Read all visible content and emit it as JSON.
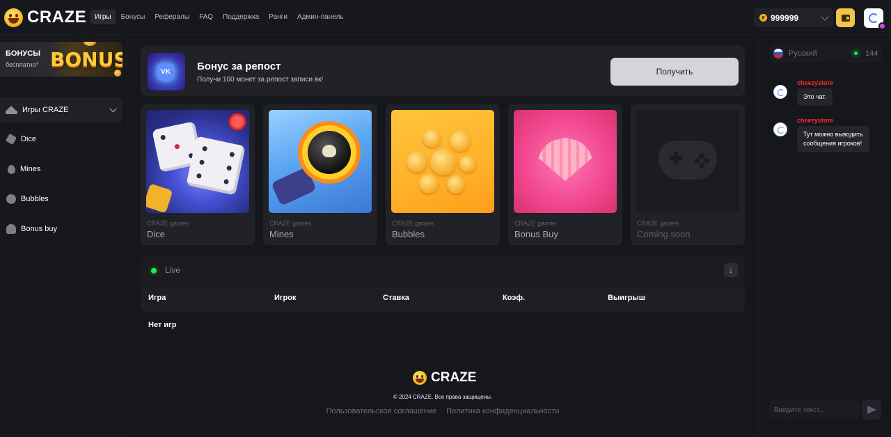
{
  "header": {
    "logo_text": "CRAZE",
    "nav": [
      {
        "label": "Игры",
        "active": true
      },
      {
        "label": "Бонусы"
      },
      {
        "label": "Рефералы"
      },
      {
        "label": "FAQ"
      },
      {
        "label": "Поддержка"
      },
      {
        "label": "Ранги"
      },
      {
        "label": "Админ-панель"
      }
    ],
    "balance": "999999",
    "coin_symbol": "₽"
  },
  "sidebar": {
    "bonus_title": "БОНУСЫ",
    "bonus_sub": "бесплатно*",
    "bonus_art": "BONUS",
    "games_toggle": "Игры CRAZE",
    "links": [
      {
        "label": "Dice",
        "icon": "dice-icon"
      },
      {
        "label": "Mines",
        "icon": "drop-icon"
      },
      {
        "label": "Bubbles",
        "icon": "smile-icon"
      },
      {
        "label": "Bonus buy",
        "icon": "shell-icon"
      }
    ]
  },
  "repost": {
    "title": "Бонус за репост",
    "subtitle": "Получи 100 монет за репост записи вк!",
    "button": "Получить",
    "badge": "VK"
  },
  "games": [
    {
      "provider": "CRAZE games",
      "name": "Dice"
    },
    {
      "provider": "CRAZE games",
      "name": "Mines"
    },
    {
      "provider": "CRAZE games",
      "name": "Bubbles"
    },
    {
      "provider": "CRAZE games",
      "name": "Bonus Buy"
    },
    {
      "provider": "CRAZE games",
      "name": "Coming soon"
    }
  ],
  "live": {
    "label": "Live",
    "columns": [
      "Игра",
      "Игрок",
      "Ставка",
      "Коэф.",
      "Выигрыш"
    ],
    "empty_text": "Нет игр"
  },
  "footer": {
    "logo_text": "CRAZE",
    "copyright": "© 2024 CRAZE. Все права защищены.",
    "links": [
      "Пользовательское соглашение",
      "Политика конфиденциальности"
    ]
  },
  "chat": {
    "language": "Русский",
    "online": "144",
    "messages": [
      {
        "user": "cheezystore",
        "text": "Это чат."
      },
      {
        "user": "cheezystore",
        "text_lines": [
          "Тут можно выводить",
          "сообщения игроков!"
        ]
      }
    ],
    "input_placeholder": "Введите текст..."
  }
}
